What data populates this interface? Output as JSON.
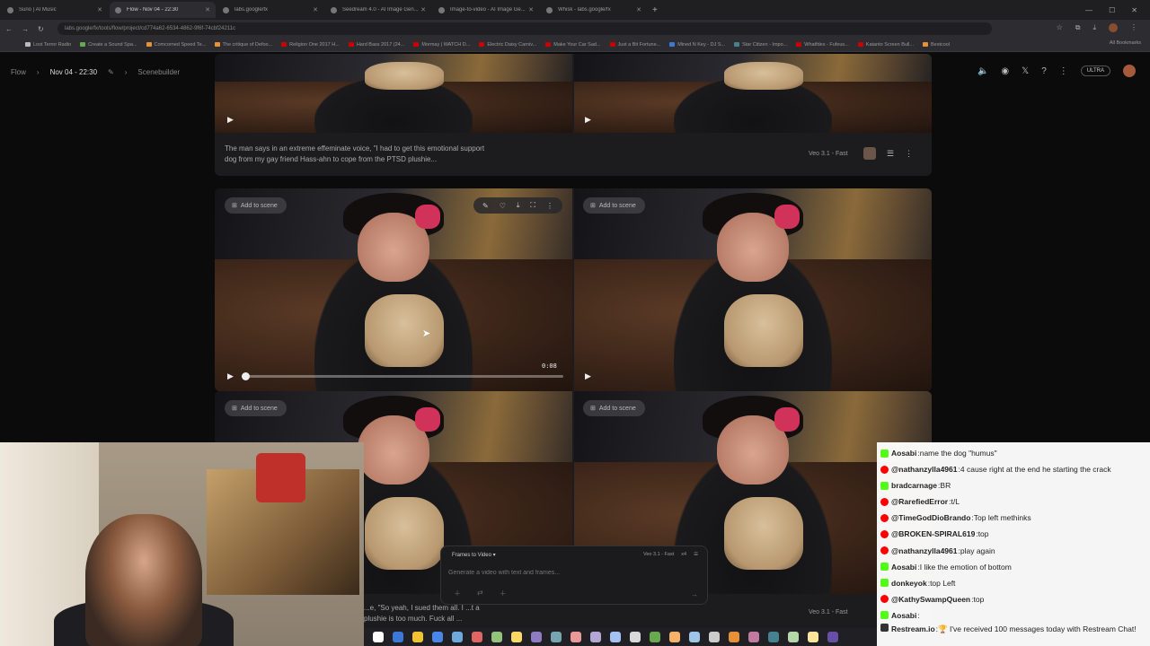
{
  "browser": {
    "tabs": [
      {
        "label": "Suno | AI Music",
        "active": false
      },
      {
        "label": "Flow - Nov 04 - 22:30",
        "active": true
      },
      {
        "label": "labs.google/fx",
        "active": false
      },
      {
        "label": "Seedream 4.0 - AI Image Gen...",
        "active": false
      },
      {
        "label": "Image-to-video - AI Image Ge...",
        "active": false
      },
      {
        "label": "Whisk - labs.google/fx",
        "active": false
      }
    ],
    "url": "labs.google/fx/tools/flow/project/cd774a62-6534-4862-9f6f-74cbf24211c",
    "bookmarks": [
      {
        "label": "Lost Terror Radio",
        "color": "#bbbbbb"
      },
      {
        "label": "Create a Sound Spa...",
        "color": "#6aa84f"
      },
      {
        "label": "Comcorned Speed Te...",
        "color": "#e69138"
      },
      {
        "label": "The critique of Defoo...",
        "color": "#e69138"
      },
      {
        "label": "Religion One 2017 H...",
        "color": "#cc0000"
      },
      {
        "label": "Hard Bass 2017 (24...",
        "color": "#cc0000"
      },
      {
        "label": "Mormay | WATCH D...",
        "color": "#cc0000"
      },
      {
        "label": "Electric Daisy Carniv...",
        "color": "#cc0000"
      },
      {
        "label": "Make Your Car Sad...",
        "color": "#cc0000"
      },
      {
        "label": "Just a Bit Fortune...",
        "color": "#cc0000"
      },
      {
        "label": "Mined N Key - DJ S...",
        "color": "#3c78d8"
      },
      {
        "label": "Star Citizen - Impo...",
        "color": "#45818e"
      },
      {
        "label": "Whatfdes - Fufeus...",
        "color": "#cc0000"
      },
      {
        "label": "Katanto Screen Bull...",
        "color": "#cc0000"
      },
      {
        "label": "Bestcool",
        "color": "#e69138"
      }
    ],
    "all_bookmarks": "All Bookmarks"
  },
  "app": {
    "breadcrumb_root": "Flow",
    "project_title": "Nov 04 - 22:30",
    "breadcrumb_view": "Scenebuilder",
    "plan_badge": "ULTRA"
  },
  "cards": {
    "top_prompt": "The man says in an extreme effeminate voice, \"I had to get this emotional support dog from my gay friend Hass-ahn to cope from the PTSD plushie...",
    "top_model": "Veo 3.1 - Fast",
    "add_to_scene": "Add to scene",
    "duration": "0:08",
    "bottom_prompt": "...e, \"So yeah, I sued them all. I ...t a plushie is too much. Fuck all ...",
    "bottom_model": "Veo 3.1 - Fast"
  },
  "generator": {
    "mode": "Frames to Video",
    "model": "Veo 3.1 - Fast",
    "count": "x4",
    "placeholder": "Generate a video with text and frames..."
  },
  "chat": [
    {
      "user": "Aosabi",
      "text": "name the dog \"humus\"",
      "platform": "kick"
    },
    {
      "user": "@nathanzylla4961",
      "text": "4 cause right at the end he starting the crack",
      "platform": "youtube"
    },
    {
      "user": "bradcarnage",
      "text": "BR",
      "platform": "kick"
    },
    {
      "user": "@RarefiedError",
      "text": "t/L",
      "platform": "youtube"
    },
    {
      "user": "@TimeGodDioBrando",
      "text": "Top left methinks",
      "platform": "youtube"
    },
    {
      "user": "@BROKEN-SPIRAL619",
      "text": "top",
      "platform": "youtube"
    },
    {
      "user": "@nathanzylla4961",
      "text": "play again",
      "platform": "youtube"
    },
    {
      "user": "Aosabi",
      "text": "I like the emotion of bottom",
      "platform": "kick"
    },
    {
      "user": "donkeyok",
      "text": "top Left",
      "platform": "kick"
    },
    {
      "user": "@KathySwampQueen",
      "text": "top",
      "platform": "youtube"
    },
    {
      "user": "Aosabi",
      "text": "",
      "platform": "kick"
    },
    {
      "user": "Restream.io",
      "text": "🏆 I've received 100 messages today with Restream Chat!",
      "platform": "restream"
    }
  ],
  "colors": {
    "kick": "#53fc18",
    "youtube": "#ff0000",
    "restream": "#333333",
    "accent": "#d0325a"
  }
}
